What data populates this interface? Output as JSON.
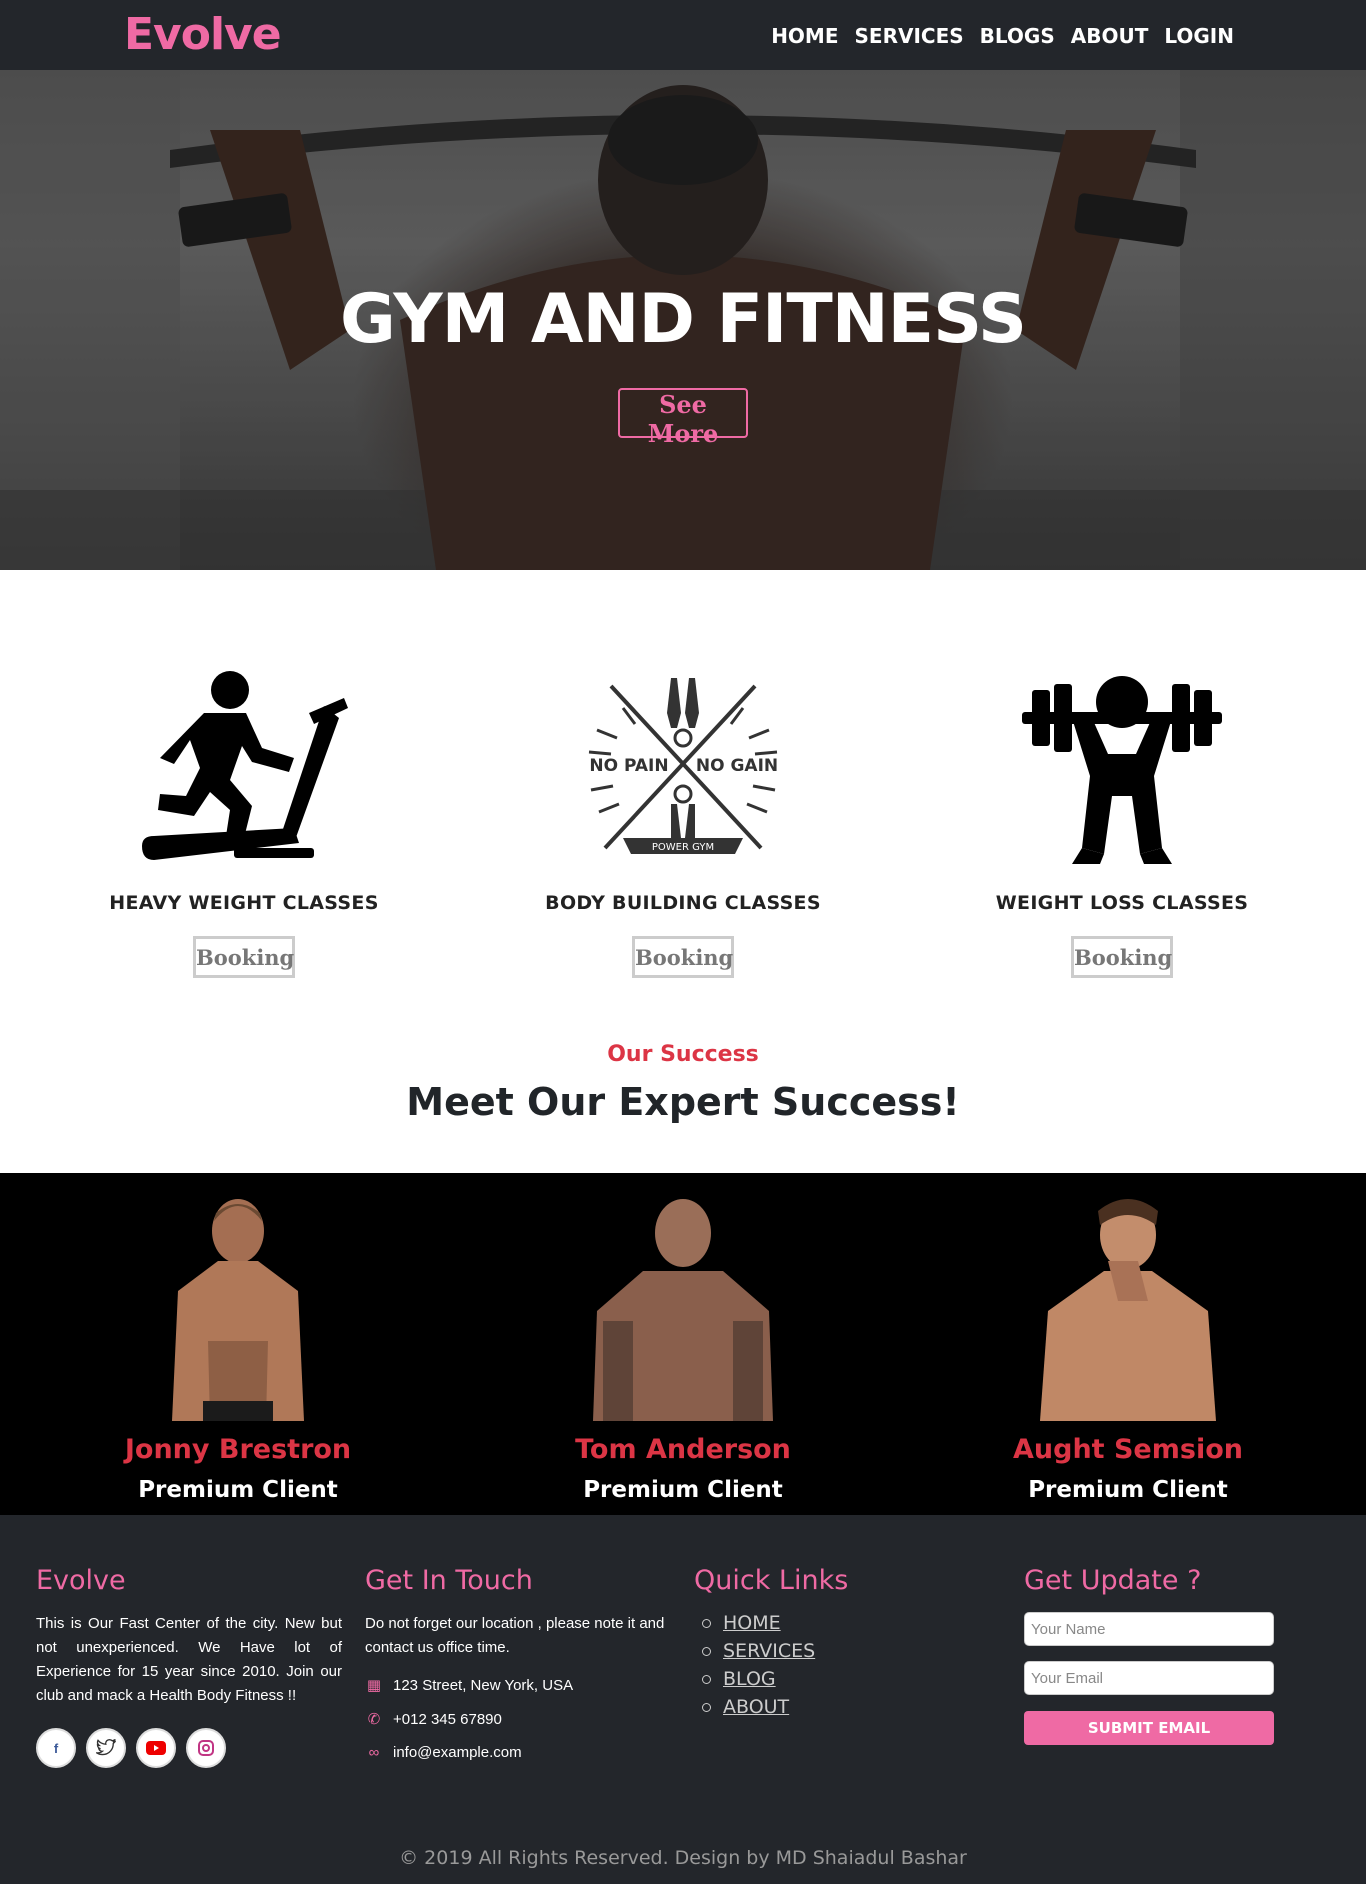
{
  "nav": {
    "brand": "Evolve",
    "links": [
      "HOME",
      "SERVICES",
      "BLOGS",
      "ABOUT",
      "LOGIN"
    ]
  },
  "hero": {
    "title": "GYM AND FITNESS",
    "button_label": "See More"
  },
  "classes": [
    {
      "name": "HEAVY WEIGHT CLASSES",
      "button": "Booking",
      "icon": "treadmill-runner-icon"
    },
    {
      "name": "BODY BUILDING CLASSES",
      "button": "Booking",
      "icon": "no-pain-no-gain-badge",
      "badge_left": "NO PAIN",
      "badge_right": "NO GAIN",
      "badge_bottom": "POWER GYM"
    },
    {
      "name": "WEIGHT LOSS CLASSES",
      "button": "Booking",
      "icon": "weightlifter-icon"
    }
  ],
  "success": {
    "eyebrow": "Our Success",
    "title": "Meet Our Expert Success!"
  },
  "clients": [
    {
      "name": "Jonny Brestron",
      "role": "Premium Client"
    },
    {
      "name": "Tom Anderson",
      "role": "Premium Client"
    },
    {
      "name": "Aught Semsion",
      "role": "Premium Client"
    }
  ],
  "footer": {
    "about": {
      "title": "Evolve",
      "text": "This is Our Fast Center of the city. New but not unexperienced. We Have lot of Experience for 15 year since 2010. Join our club and mack a Health Body Fitness !!"
    },
    "contact": {
      "title": "Get In Touch",
      "text": "Do not forget our location , please note it and contact us office time.",
      "address": "123 Street, New York, USA",
      "phone": "+012 345 67890",
      "email": "info@example.com"
    },
    "links": {
      "title": "Quick Links",
      "items": [
        "HOME",
        "SERVICES",
        "BLOG",
        "ABOUT"
      ]
    },
    "update": {
      "title": "Get Update ?",
      "name_placeholder": "Your Name",
      "email_placeholder": "Your Email",
      "submit_label": "SUBMIT EMAIL"
    },
    "copyright": "© 2019 All Rights Reserved. Design by MD Shaiadul Bashar"
  },
  "colors": {
    "accent_pink": "#ef6aa4",
    "accent_red": "#dc3545",
    "dark_bg": "#23262b"
  }
}
